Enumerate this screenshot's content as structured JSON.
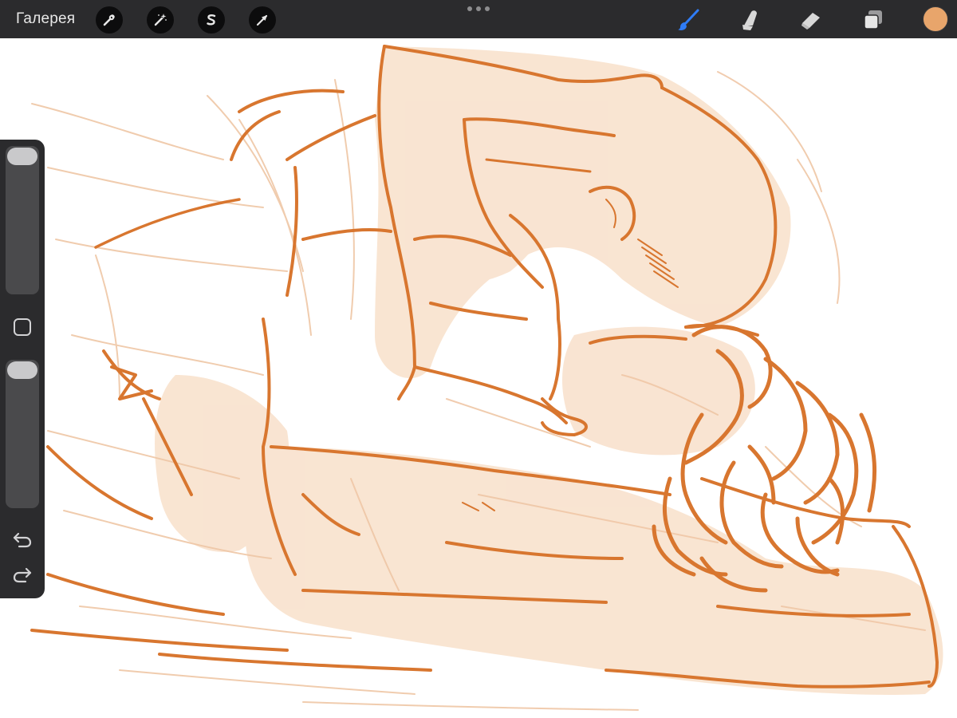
{
  "app": {
    "gallery_label": "Галерея",
    "accent_color": "#2f7cf6",
    "current_color": "#e8a56b",
    "stroke_color": "#d8762f",
    "fill_color": "#f7dcc3"
  },
  "toolbar_left": [
    {
      "name": "actions",
      "icon": "wrench-icon"
    },
    {
      "name": "adjustments",
      "icon": "magic-wand-icon"
    },
    {
      "name": "selection",
      "icon": "selection-s-icon"
    },
    {
      "name": "transform",
      "icon": "arrow-cursor-icon"
    }
  ],
  "toolbar_right": [
    {
      "name": "brush",
      "icon": "brush-icon",
      "active": true
    },
    {
      "name": "smudge",
      "icon": "smudge-icon",
      "active": false
    },
    {
      "name": "eraser",
      "icon": "eraser-icon",
      "active": false
    },
    {
      "name": "layers",
      "icon": "layers-icon",
      "active": false
    }
  ],
  "sidebar": {
    "brush_size_level": 0.0,
    "opacity_level": 0.0,
    "modify_button_icon": "square-icon",
    "undo_icon": "undo-icon",
    "redo_icon": "redo-icon"
  }
}
